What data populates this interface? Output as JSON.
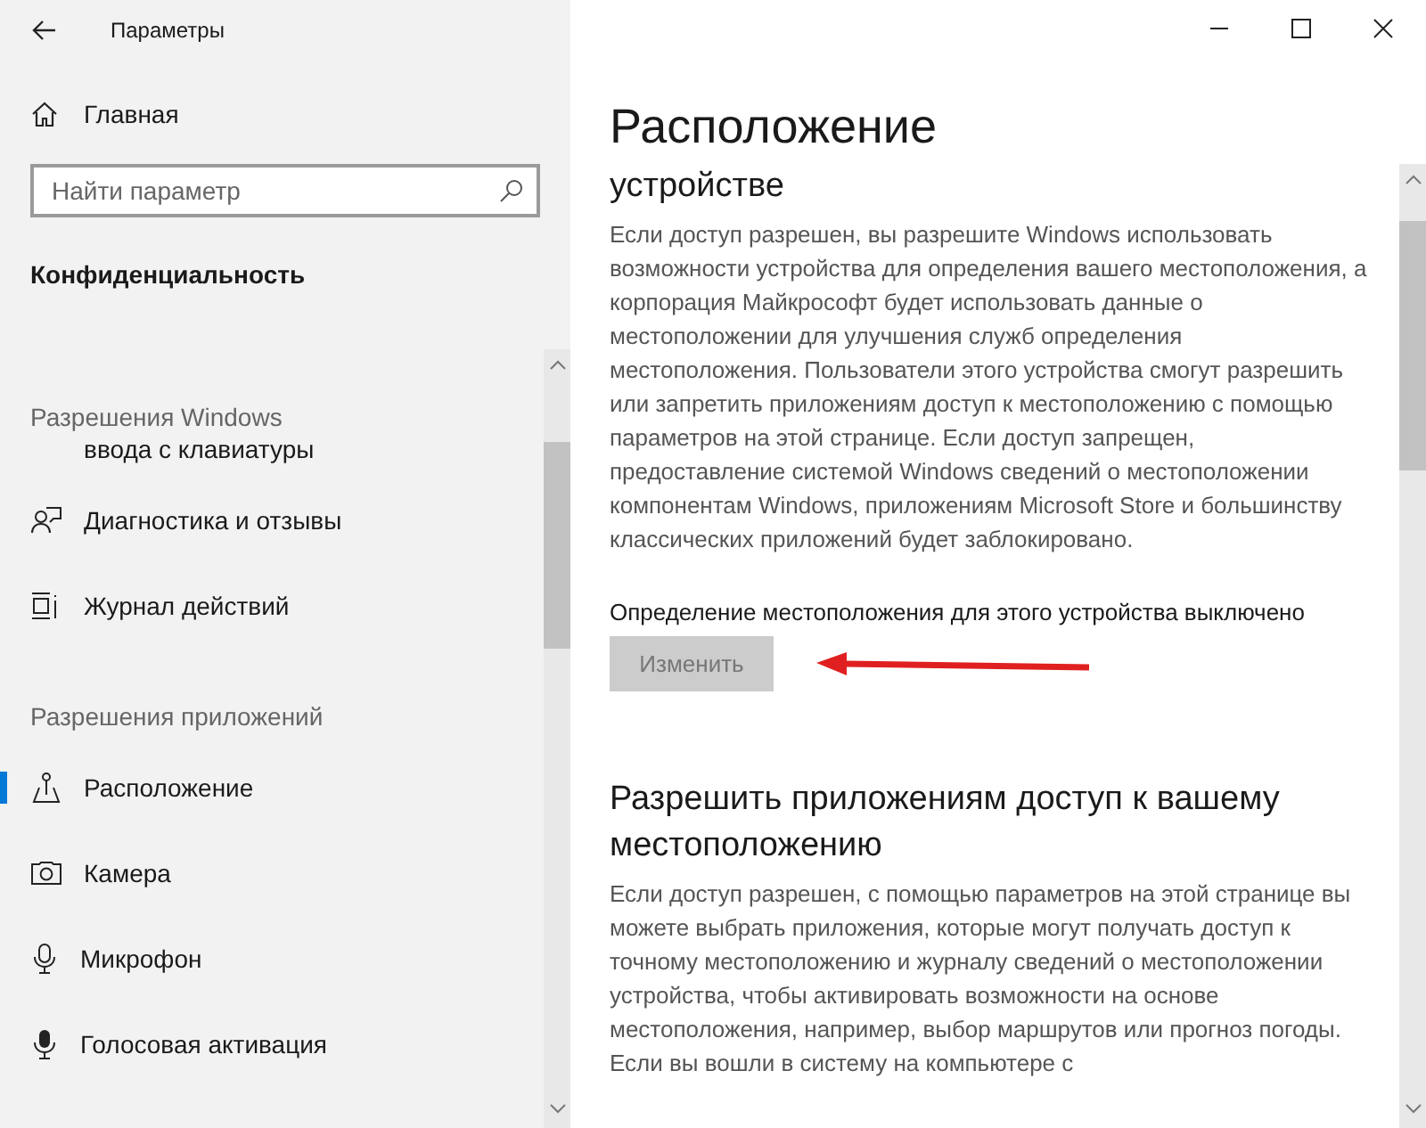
{
  "window": {
    "title": "Параметры"
  },
  "sidebar": {
    "home": {
      "label": "Главная"
    },
    "search": {
      "placeholder": "Найти параметр"
    },
    "section_title": "Конфиденциальность",
    "groups": [
      {
        "heading": "Разрешения Windows",
        "items": [
          {
            "kind": "partial",
            "label": "ввода с клавиатуры",
            "selected": false
          },
          {
            "kind": "diagnostics",
            "label": "Диагностика и отзывы",
            "selected": false
          },
          {
            "kind": "activity",
            "label": "Журнал действий",
            "selected": false
          }
        ]
      },
      {
        "heading": "Разрешения приложений",
        "items": [
          {
            "kind": "location",
            "label": "Расположение",
            "selected": true
          },
          {
            "kind": "camera",
            "label": "Камера",
            "selected": false
          },
          {
            "kind": "microphone",
            "label": "Микрофон",
            "selected": false
          },
          {
            "kind": "voice",
            "label": "Голосовая активация",
            "selected": false
          }
        ]
      }
    ]
  },
  "content": {
    "title": "Расположение",
    "section_tail": "устройстве",
    "description": "Если доступ разрешен, вы разрешите Windows использовать возможности устройства для определения вашего местоположения, а корпорация Майкрософт будет использовать данные о местоположении для улучшения служб определения местоположения. Пользователи этого устройства смогут разрешить или запретить приложениям доступ к местоположению с помощью параметров на этой странице. Если доступ запрещен, предоставление системой Windows сведений о местоположении компонентам Windows, приложениям Microsoft Store и большинству классических приложений будет заблокировано.",
    "status": "Определение местоположения для этого устройства выключено",
    "change_button": {
      "label": "Изменить",
      "disabled": true
    },
    "apps_heading": "Разрешить приложениям доступ к вашему местоположению",
    "apps_description": "Если доступ разрешен, с помощью параметров на этой странице вы можете выбрать приложения, которые могут получать доступ к точному местоположению и журналу сведений о местоположении устройства, чтобы активировать возможности на основе местоположения, например, выбор маршрутов или прогноз погоды. Если вы вошли в систему на компьютере с"
  }
}
